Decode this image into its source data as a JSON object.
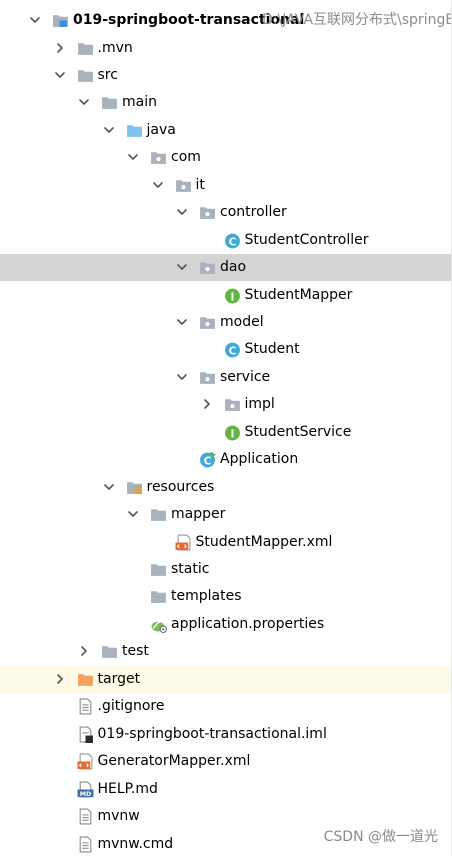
{
  "project": {
    "name": "019-springboot-transactional",
    "path": "D:\\JAVA互联网分布式\\springB"
  },
  "tree": [
    {
      "label": "019-springboot-transactional",
      "level": 0,
      "chevron": "down",
      "icon": "module-folder",
      "bold": true,
      "path": "D:\\JAVA互联网分布式\\springB"
    },
    {
      "label": ".mvn",
      "level": 1,
      "chevron": "right",
      "icon": "folder"
    },
    {
      "label": "src",
      "level": 1,
      "chevron": "down",
      "icon": "folder"
    },
    {
      "label": "main",
      "level": 2,
      "chevron": "down",
      "icon": "folder"
    },
    {
      "label": "java",
      "level": 3,
      "chevron": "down",
      "icon": "source-folder"
    },
    {
      "label": "com",
      "level": 4,
      "chevron": "down",
      "icon": "package"
    },
    {
      "label": "it",
      "level": 5,
      "chevron": "down",
      "icon": "package"
    },
    {
      "label": "controller",
      "level": 6,
      "chevron": "down",
      "icon": "package"
    },
    {
      "label": "StudentController",
      "level": 7,
      "chevron": "none",
      "icon": "class"
    },
    {
      "label": "dao",
      "level": 6,
      "chevron": "down",
      "icon": "package",
      "selected": true
    },
    {
      "label": "StudentMapper",
      "level": 7,
      "chevron": "none",
      "icon": "interface"
    },
    {
      "label": "model",
      "level": 6,
      "chevron": "down",
      "icon": "package"
    },
    {
      "label": "Student",
      "level": 7,
      "chevron": "none",
      "icon": "class"
    },
    {
      "label": "service",
      "level": 6,
      "chevron": "down",
      "icon": "package"
    },
    {
      "label": "impl",
      "level": 7,
      "chevron": "right",
      "icon": "package"
    },
    {
      "label": "StudentService",
      "level": 7,
      "chevron": "none",
      "icon": "interface"
    },
    {
      "label": "Application",
      "level": 6,
      "chevron": "none",
      "icon": "spring-app-class"
    },
    {
      "label": "resources",
      "level": 3,
      "chevron": "down",
      "icon": "resources-folder"
    },
    {
      "label": "mapper",
      "level": 4,
      "chevron": "down",
      "icon": "folder"
    },
    {
      "label": "StudentMapper.xml",
      "level": 5,
      "chevron": "none",
      "icon": "xml-file"
    },
    {
      "label": "static",
      "level": 4,
      "chevron": "none",
      "icon": "folder"
    },
    {
      "label": "templates",
      "level": 4,
      "chevron": "none",
      "icon": "folder"
    },
    {
      "label": "application.properties",
      "level": 4,
      "chevron": "none",
      "icon": "spring-properties"
    },
    {
      "label": "test",
      "level": 2,
      "chevron": "right",
      "icon": "folder"
    },
    {
      "label": "target",
      "level": 1,
      "chevron": "right",
      "icon": "excluded-folder",
      "excluded": true
    },
    {
      "label": ".gitignore",
      "level": 1,
      "chevron": "none",
      "icon": "text-file"
    },
    {
      "label": "019-springboot-transactional.iml",
      "level": 1,
      "chevron": "none",
      "icon": "iml-file"
    },
    {
      "label": "GeneratorMapper.xml",
      "level": 1,
      "chevron": "none",
      "icon": "xml-file"
    },
    {
      "label": "HELP.md",
      "level": 1,
      "chevron": "none",
      "icon": "markdown-file"
    },
    {
      "label": "mvnw",
      "level": 1,
      "chevron": "none",
      "icon": "text-file"
    },
    {
      "label": "mvnw.cmd",
      "level": 1,
      "chevron": "none",
      "icon": "text-file"
    }
  ],
  "watermark": "CSDN @做一道光",
  "colors": {
    "folder": "#a9b1bd",
    "source_folder": "#7ec4ee",
    "excluded_folder": "#f4a261",
    "class": "#3fa9d8",
    "interface": "#62b543",
    "selection": "#d4d4d4",
    "excluded_bg": "#fdfbe8",
    "path_text": "#8c8c8c"
  }
}
